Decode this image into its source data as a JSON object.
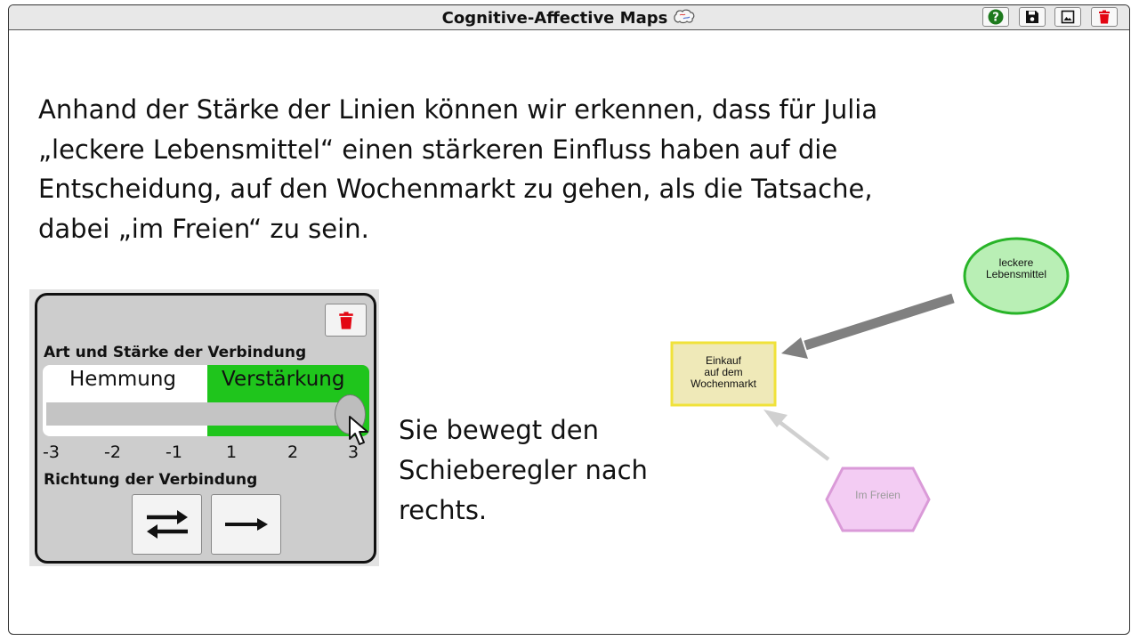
{
  "app": {
    "title": "Cognitive-Affective Maps",
    "buttons": [
      {
        "name": "help-button",
        "icon": "question-circle-icon"
      },
      {
        "name": "save-button",
        "icon": "floppy-disk-icon"
      },
      {
        "name": "image-button",
        "icon": "image-icon"
      },
      {
        "name": "delete-button",
        "icon": "trash-icon"
      }
    ]
  },
  "explanation": "Anhand der Stärke der Linien können wir erkennen, dass für Julia „leckere Lebensmittel“ einen stärkeren Einfluss haben auf die Entscheidung, auf den Wochenmarkt zu gehen, als die Tatsache, dabei „im Freien“ zu sein.",
  "panel": {
    "strength_heading": "Art und Stärke der Verbindung",
    "inhibition_label": "Hemmung",
    "amplification_label": "Verstärkung",
    "ticks": [
      "-3",
      "-2",
      "-1",
      "1",
      "2",
      "3"
    ],
    "slider_value": 3,
    "direction_heading": "Richtung der Verbindung",
    "direction_options": [
      "bidirectional-arrows-icon",
      "right-arrow-icon"
    ]
  },
  "caption": "Sie bewegt den Schieberegler nach rechts.",
  "map": {
    "nodes": [
      {
        "id": "leckere",
        "text_line1": "leckere",
        "text_line2": "Lebensmittel",
        "shape": "ellipse",
        "color": "#b9efb5"
      },
      {
        "id": "einkauf",
        "text_line1": "Einkauf",
        "text_line2": "auf dem",
        "text_line3": "Wochenmarkt",
        "shape": "rectangle",
        "color": "#efe9b8"
      },
      {
        "id": "freien",
        "text": "Im Freien",
        "shape": "hexagon",
        "color": "#f3ccf3"
      }
    ],
    "edges": [
      {
        "from": "leckere",
        "to": "einkauf",
        "strength": 3
      },
      {
        "from": "freien",
        "to": "einkauf",
        "strength": 1
      }
    ]
  },
  "colors": {
    "accent_green": "#1fc51c",
    "delete_red": "#e30613",
    "help_green": "#1e7a1e"
  }
}
